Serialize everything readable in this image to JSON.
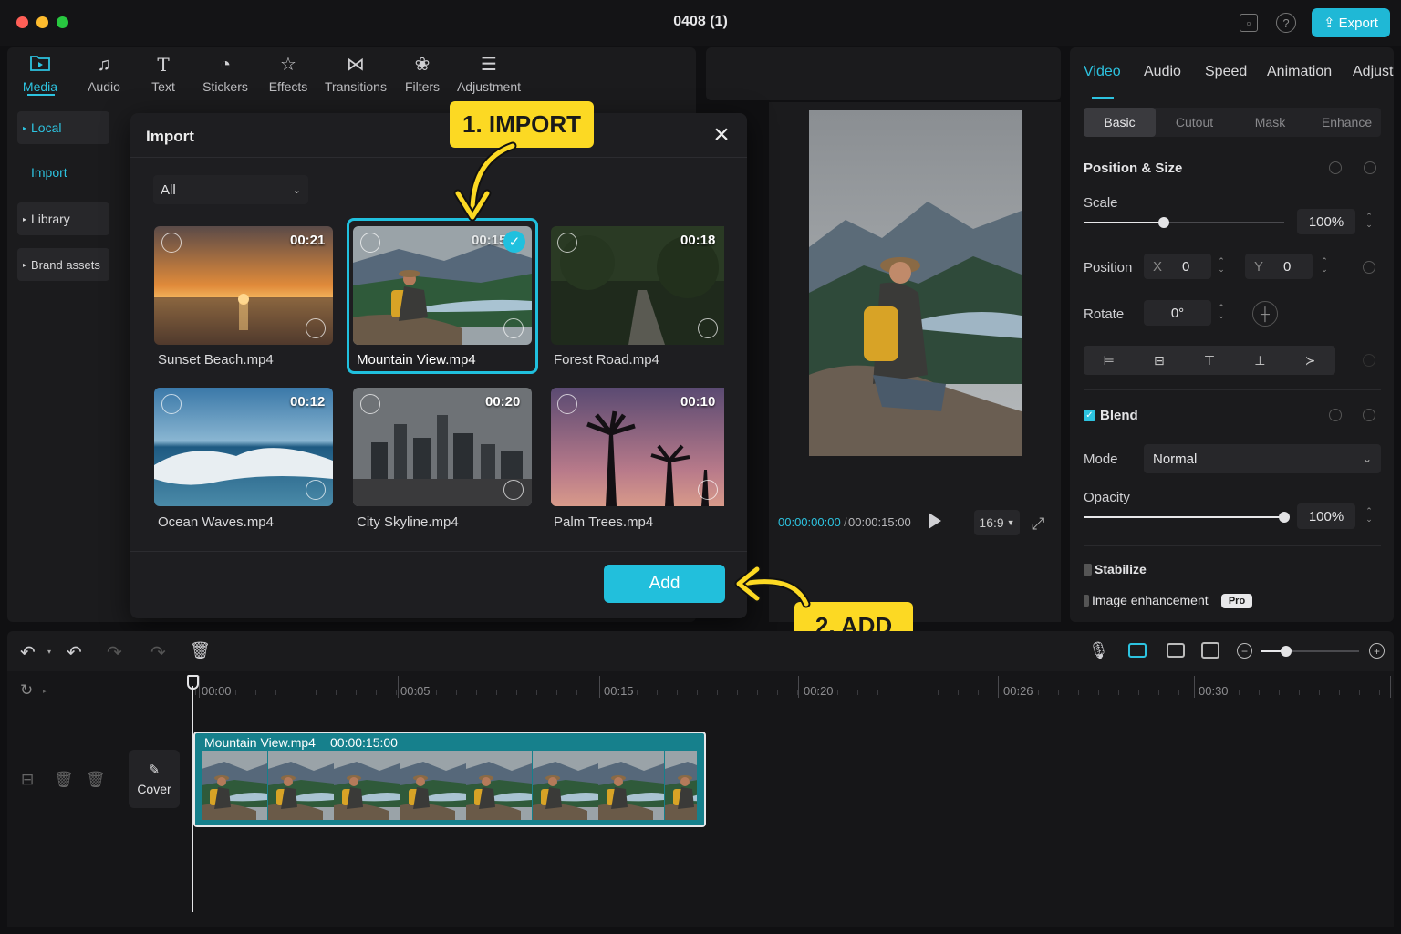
{
  "window": {
    "title": "0408 (1)",
    "export_label": "Export"
  },
  "media_tabs": [
    {
      "label": "Media",
      "icon": "media-folder-icon"
    },
    {
      "label": "Audio",
      "icon": "music-note-icon"
    },
    {
      "label": "Text",
      "icon": "text-t-icon"
    },
    {
      "label": "Stickers",
      "icon": "sticker-icon"
    },
    {
      "label": "Effects",
      "icon": "star-sparkle-icon"
    },
    {
      "label": "Transitions",
      "icon": "bowtie-icon"
    },
    {
      "label": "Filters",
      "icon": "filter-drops-icon"
    },
    {
      "label": "Adjustment",
      "icon": "sliders-icon"
    }
  ],
  "sidebar": {
    "local": "Local",
    "import": "Import",
    "library": "Library",
    "brand_assets": "Brand assets"
  },
  "import_dialog": {
    "title": "Import",
    "filter": "All",
    "files": [
      {
        "name": "Sunset Beach.mp4",
        "duration": "00:21",
        "selected": false
      },
      {
        "name": "Mountain View.mp4",
        "duration": "00:15",
        "selected": true
      },
      {
        "name": "Forest Road.mp4",
        "duration": "00:18",
        "selected": false
      },
      {
        "name": "Ocean Waves.mp4",
        "duration": "00:12",
        "selected": false
      },
      {
        "name": "City Skyline.mp4",
        "duration": "00:20",
        "selected": false
      },
      {
        "name": "Palm Trees.mp4",
        "duration": "00:10",
        "selected": false
      }
    ],
    "add_label": "Add"
  },
  "callouts": {
    "import": "1. IMPORT",
    "add": "2. ADD"
  },
  "player": {
    "current_time": "00:00:00:00",
    "separator": "/",
    "total_time": "00:00:15:00",
    "ratio": "16:9"
  },
  "properties": {
    "tabs": [
      "Video",
      "Audio",
      "Speed",
      "Animation",
      "Adjust"
    ],
    "subtabs": [
      "Basic",
      "Cutout",
      "Mask",
      "Enhance"
    ],
    "position_size": "Position & Size",
    "scale_label": "Scale",
    "scale_value": "100%",
    "scale_fraction": 0.4,
    "position_label": "Position",
    "x_label": "X",
    "x_value": "0",
    "y_label": "Y",
    "y_value": "0",
    "rotate_label": "Rotate",
    "rotate_value": "0°",
    "blend_label": "Blend",
    "mode_label": "Mode",
    "mode_value": "Normal",
    "opacity_label": "Opacity",
    "opacity_value": "100%",
    "opacity_fraction": 1.0,
    "stabilize_label": "Stabilize",
    "enhance_label": "Image enhancement",
    "pro_badge": "Pro"
  },
  "timeline": {
    "ticks": [
      "00:00",
      "00:05",
      "00:15",
      "00:20",
      "00:26",
      "00:30"
    ],
    "cover_label": "Cover",
    "clip_name": "Mountain View.mp4",
    "clip_duration": "00:00:15:00"
  },
  "colors": {
    "accent": "#1fb8d6",
    "callout": "#fcd923",
    "clip": "#16808c"
  }
}
